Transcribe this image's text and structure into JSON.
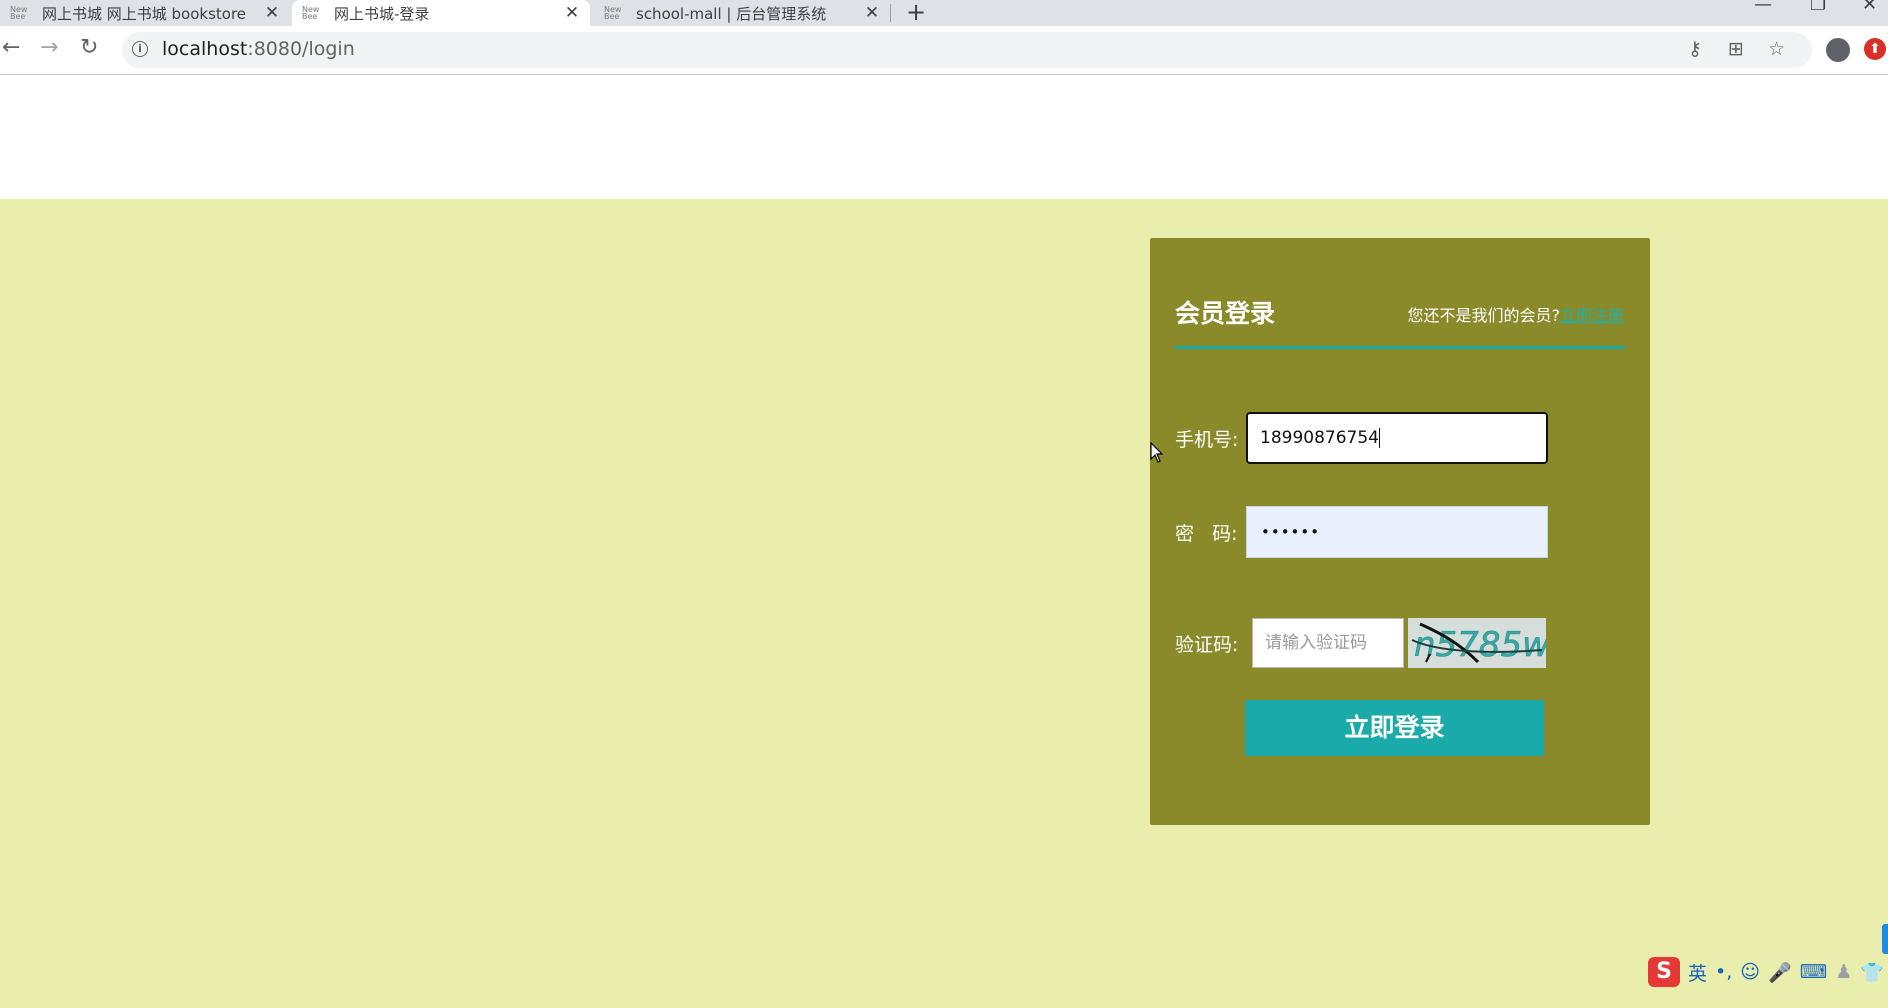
{
  "browser": {
    "tabs": [
      {
        "title": "网上书城 网上书城 bookstore",
        "favicon": "new-page-icon",
        "close": "✕"
      },
      {
        "title": "网上书城-登录",
        "favicon": "new-page-icon",
        "close": "✕"
      },
      {
        "title": "school-mall | 后台管理系统",
        "favicon": "new-page-icon",
        "close": "✕"
      }
    ],
    "favicon_text": "New\nBee",
    "new_tab": "+",
    "address": {
      "host": "localhost",
      "rest": ":8080/login"
    }
  },
  "login": {
    "title": "会员登录",
    "register_prompt": "您还不是我们的会员?",
    "register_link": "立即注册",
    "phone_label": "手机号:",
    "phone_value": "18990876754",
    "password_label": "密   码:",
    "password_value": "••••••",
    "captcha_label": "验证码:",
    "captcha_placeholder": "请输入验证码",
    "captcha_text": "n5785w",
    "login_button": "立即登录"
  },
  "ime": {
    "logo": "S",
    "mode": "英"
  },
  "colors": {
    "page_bg": "#e9eeac",
    "panel_bg": "#8a8a2a",
    "accent": "#1aaaa9"
  }
}
